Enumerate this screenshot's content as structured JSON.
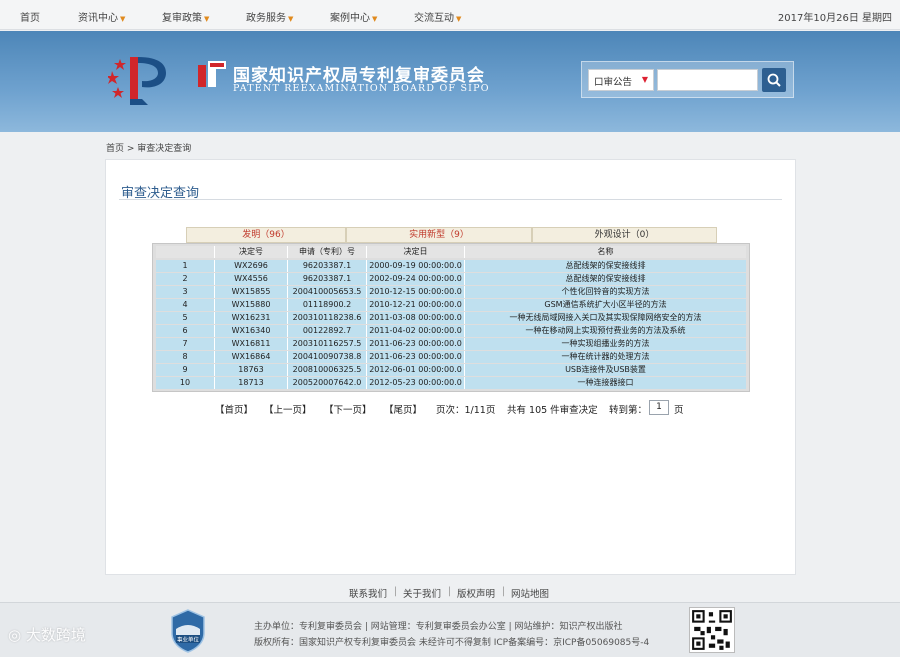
{
  "topnav": {
    "items": [
      {
        "label": "首页",
        "has_menu": false
      },
      {
        "label": "资讯中心",
        "has_menu": true
      },
      {
        "label": "复审政策",
        "has_menu": true
      },
      {
        "label": "政务服务",
        "has_menu": true
      },
      {
        "label": "案例中心",
        "has_menu": true
      },
      {
        "label": "交流互动",
        "has_menu": true
      }
    ],
    "date": "2017年10月26日 星期四",
    "menu_arrow": "▼"
  },
  "banner": {
    "title_cn": "国家知识产权局专利复审委员会",
    "title_en": "PATENT REEXAMINATION BOARD OF SIPO",
    "colors": {
      "banner_top": "#4d86b8",
      "banner_bottom": "#8db8dc",
      "emblem_red": "#d0262b",
      "emblem_blue": "#1c4f86"
    }
  },
  "search": {
    "select_value": "口审公告",
    "input_value": "",
    "button_icon": "search-icon"
  },
  "breadcrumb": {
    "text": "首页 > 审查决定查询"
  },
  "content": {
    "title": "审查决定查询",
    "tabs": [
      {
        "label": "发明（96）",
        "highlight": true
      },
      {
        "label": "实用新型（9）",
        "highlight": true
      },
      {
        "label": "外观设计（0）",
        "highlight": false
      }
    ],
    "table": {
      "columns": [
        "",
        "决定号",
        "申请（专利）号",
        "决定日",
        "名称"
      ],
      "rows": [
        [
          "1",
          "WX2696",
          "96203387.1",
          "2000-09-19 00:00:00.0",
          "总配线架的保安接线排"
        ],
        [
          "2",
          "WX4556",
          "96203387.1",
          "2002-09-24 00:00:00.0",
          "总配线架的保安接线排"
        ],
        [
          "3",
          "WX15855",
          "200410005653.5",
          "2010-12-15 00:00:00.0",
          "个性化回铃音的实现方法"
        ],
        [
          "4",
          "WX15880",
          "01118900.2",
          "2010-12-21 00:00:00.0",
          "GSM通信系统扩大小区半径的方法"
        ],
        [
          "5",
          "WX16231",
          "200310118238.6",
          "2011-03-08 00:00:00.0",
          "一种无线局域网接入关口及其实现保障网络安全的方法"
        ],
        [
          "6",
          "WX16340",
          "00122892.7",
          "2011-04-02 00:00:00.0",
          "一种在移动网上实现预付费业务的方法及系统"
        ],
        [
          "7",
          "WX16811",
          "200310116257.5",
          "2011-06-23 00:00:00.0",
          "一种实现组播业务的方法"
        ],
        [
          "8",
          "WX16864",
          "200410090738.8",
          "2011-06-23 00:00:00.0",
          "一种在统计器的处理方法"
        ],
        [
          "9",
          "18763",
          "200810006325.5",
          "2012-06-01 00:00:00.0",
          "USB连接件及USB装置"
        ],
        [
          "10",
          "18713",
          "200520007642.0",
          "2012-05-23 00:00:00.0",
          "一种连接器接口"
        ]
      ]
    },
    "pager": {
      "first": "【首页】",
      "prev": "【上一页】",
      "next": "【下一页】",
      "last": "【尾页】",
      "page_info": "页次：1/11页",
      "total_info": "共有 105 件审查决定",
      "goto_label": "转到第：",
      "goto_value": "1",
      "goto_suffix": "页"
    }
  },
  "footer": {
    "links": [
      "联系我们",
      "关于我们",
      "版权声明",
      "网站地图"
    ],
    "separator": "|",
    "line1": "主办单位：专利复审委员会 | 网站管理：专利复审委员会办公室 | 网站维护：知识产权出版社",
    "line2": "版权所有：国家知识产权专利复审委员会 未经许可不得复制 ICP备案编号：京ICP备05069085号-4",
    "badge_text": "事业单位",
    "watermark": "大数跨境"
  }
}
